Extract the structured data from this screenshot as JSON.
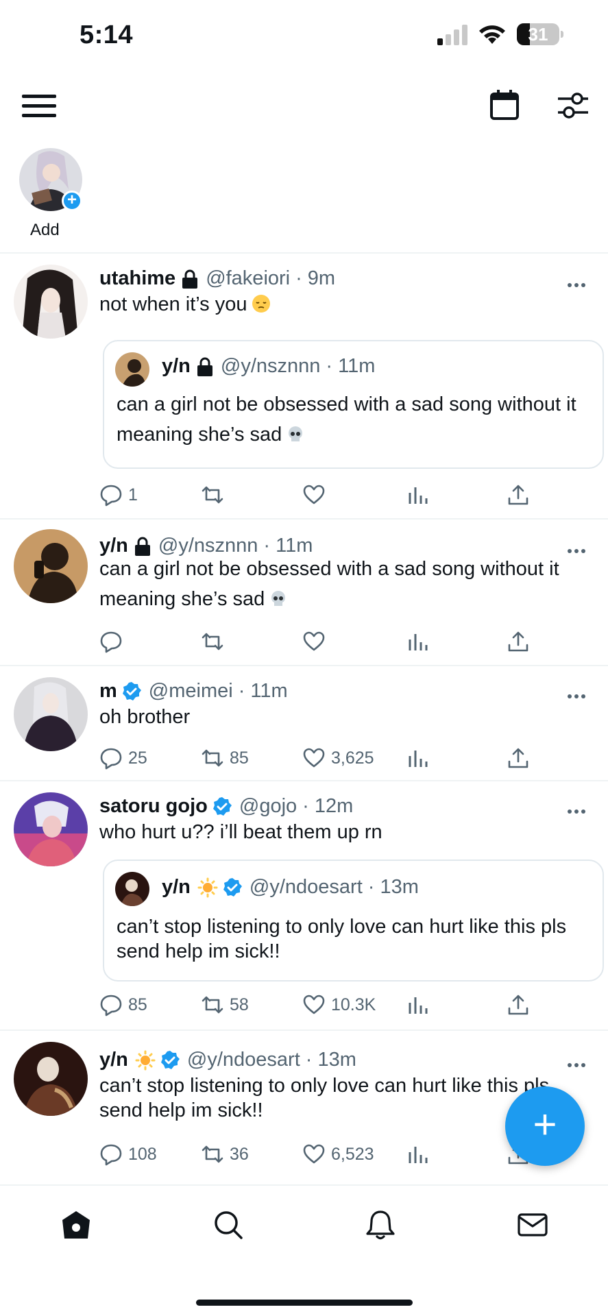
{
  "status_bar": {
    "time": "5:14",
    "battery": "31",
    "battery_level": 0.31
  },
  "stories": {
    "add_label": "Add"
  },
  "tweets": [
    {
      "name": "utahime",
      "handle": "@fakeiori",
      "time": "9m",
      "locked": true,
      "text": "not when it’s you",
      "quote": {
        "name": "y/n",
        "handle": "@y/nsznnn",
        "time": "11m",
        "locked": true,
        "text": "can a girl not be obsessed with a sad song without it meaning she’s sad"
      },
      "replies": "1",
      "retweets": "",
      "likes": ""
    },
    {
      "name": "y/n",
      "handle": "@y/nsznnn",
      "time": "11m",
      "locked": true,
      "text": "can a girl not be obsessed with a sad song without it meaning she’s sad",
      "replies": "",
      "retweets": "",
      "likes": ""
    },
    {
      "name": "m",
      "handle": "@meimei",
      "time": "11m",
      "verified": true,
      "text": "oh brother",
      "replies": "25",
      "retweets": "85",
      "likes": "3,625"
    },
    {
      "name": "satoru gojo",
      "handle": "@gojo",
      "time": "12m",
      "verified": true,
      "text": "who hurt u?? i’ll beat them up rn",
      "quote": {
        "name": "y/n",
        "handle": "@y/ndoesart",
        "time": "13m",
        "verified": true,
        "text": "can’t stop listening to only love can hurt like this pls send help im sick!!"
      },
      "replies": "85",
      "retweets": "58",
      "likes": "10.3K"
    },
    {
      "name": "y/n",
      "handle": "@y/ndoesart",
      "time": "13m",
      "verified": true,
      "text": "can’t stop listening to only love can hurt like this pls send help im sick!!",
      "replies": "108",
      "retweets": "36",
      "likes": "6,523"
    }
  ],
  "colors": {
    "accent": "#1d9bf0",
    "text": "#0f1419",
    "muted": "#536471"
  },
  "nav": [
    "home-icon",
    "search-icon",
    "bell-icon",
    "mail-icon"
  ]
}
